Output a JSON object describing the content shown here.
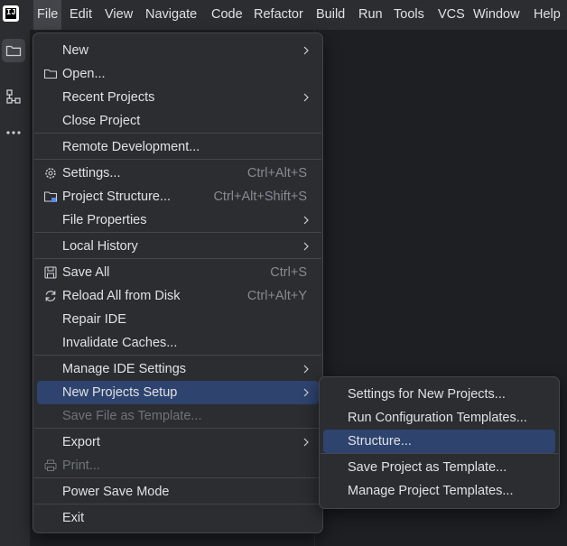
{
  "app": {
    "logo_text": "IJ"
  },
  "menubar": {
    "items": [
      {
        "label": "File",
        "active": true
      },
      {
        "label": "Edit"
      },
      {
        "label": "View"
      },
      {
        "label": "Navigate"
      },
      {
        "label": "Code"
      },
      {
        "label": "Refactor"
      },
      {
        "label": "Build"
      },
      {
        "label": "Run"
      },
      {
        "label": "Tools"
      },
      {
        "label": "VCS"
      },
      {
        "label": "Window"
      },
      {
        "label": "Help"
      }
    ]
  },
  "sidebar": {
    "items": [
      {
        "icon": "folder-icon",
        "selected": true
      },
      {
        "icon": "structure-icon"
      },
      {
        "icon": "more-icon"
      }
    ]
  },
  "file_menu": {
    "new": "New",
    "open": "Open...",
    "recent_projects": "Recent Projects",
    "close_project": "Close Project",
    "remote_development": "Remote Development...",
    "settings": "Settings...",
    "settings_shortcut": "Ctrl+Alt+S",
    "project_structure": "Project Structure...",
    "project_structure_shortcut": "Ctrl+Alt+Shift+S",
    "file_properties": "File Properties",
    "local_history": "Local History",
    "save_all": "Save All",
    "save_all_shortcut": "Ctrl+S",
    "reload_all": "Reload All from Disk",
    "reload_all_shortcut": "Ctrl+Alt+Y",
    "repair_ide": "Repair IDE",
    "invalidate_caches": "Invalidate Caches...",
    "manage_ide_settings": "Manage IDE Settings",
    "new_projects_setup": "New Projects Setup",
    "save_file_as_template": "Save File as Template...",
    "export": "Export",
    "print": "Print...",
    "power_save_mode": "Power Save Mode",
    "exit": "Exit"
  },
  "submenu": {
    "settings_for_new_projects": "Settings for New Projects...",
    "run_configuration_templates": "Run Configuration Templates...",
    "structure": "Structure...",
    "save_project_as_template": "Save Project as Template...",
    "manage_project_templates": "Manage Project Templates..."
  },
  "colors": {
    "background": "#1e1f22",
    "menu_background": "#2b2d30",
    "highlight": "#2e436e",
    "text": "#dfe1e5",
    "shortcut_text": "#868a91",
    "disabled_text": "#6f737a"
  }
}
